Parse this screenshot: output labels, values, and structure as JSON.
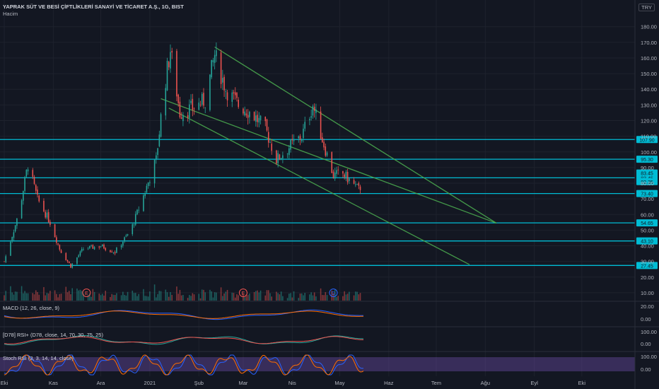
{
  "header": {
    "title": "YAPRAK SÜT VE BESİ ÇİFTLİKLERİ SANAYİ VE TİCARET A.Ş., 1G, BIST",
    "volume_label": "Hacim",
    "currency": "TRY"
  },
  "indicators": {
    "macd_label": "MACD (12, 26, close, 9)",
    "rsi_label": "[D78] RSI+ (D78, close, 14, 70, 30, 75, 25)",
    "stoch_label": "Stoch RSI (3, 3, 14, 14, close)"
  },
  "colors": {
    "background": "#131722",
    "up": "#26a69a",
    "down": "#ef5350",
    "level_line": "#00bcd4",
    "channel_line": "#4caf50",
    "macd_line": "#2962ff",
    "signal_line": "#ff6d00",
    "stoch_k": "#2962ff",
    "stoch_d": "#ff6d00",
    "stoch_band": "#7e57c2"
  },
  "chart_data": {
    "type": "candlestick",
    "y_axis": {
      "ticks": [
        10,
        20,
        30,
        40,
        50,
        60,
        70,
        80,
        90,
        100,
        110,
        120,
        130,
        140,
        150,
        160,
        170,
        180
      ],
      "tick_labels": [
        "10.00",
        "20.00",
        "30.00",
        "40.00",
        "50.00",
        "60.00",
        "70.00",
        "80.00",
        "90.00",
        "100.00",
        "110.00",
        "120.00",
        "130.00",
        "140.00",
        "150.00",
        "160.00",
        "170.00",
        "180.00"
      ],
      "range": [
        5,
        188
      ]
    },
    "x_axis": {
      "range": [
        "2020-10-01",
        "2021-10-31"
      ],
      "ticks": [
        {
          "date": "2020-10-01",
          "label": "Eki"
        },
        {
          "date": "2020-11-01",
          "label": "Kas"
        },
        {
          "date": "2020-12-01",
          "label": "Ara"
        },
        {
          "date": "2021-01-01",
          "label": "2021"
        },
        {
          "date": "2021-02-01",
          "label": "Şub"
        },
        {
          "date": "2021-03-01",
          "label": "Mar"
        },
        {
          "date": "2021-04-01",
          "label": "Nis"
        },
        {
          "date": "2021-05-01",
          "label": "May"
        },
        {
          "date": "2021-06-01",
          "label": "Haz"
        },
        {
          "date": "2021-07-01",
          "label": "Tem"
        },
        {
          "date": "2021-08-01",
          "label": "Ağu"
        },
        {
          "date": "2021-09-01",
          "label": "Eyl"
        },
        {
          "date": "2021-10-01",
          "label": "Eki"
        }
      ]
    },
    "price_path": [
      {
        "date": "2020-10-01",
        "close": 30
      },
      {
        "date": "2020-10-10",
        "close": 60
      },
      {
        "date": "2020-10-16",
        "close": 92
      },
      {
        "date": "2020-10-22",
        "close": 70
      },
      {
        "date": "2020-10-30",
        "close": 55
      },
      {
        "date": "2020-11-05",
        "close": 38
      },
      {
        "date": "2020-11-12",
        "close": 27
      },
      {
        "date": "2020-11-20",
        "close": 38
      },
      {
        "date": "2020-12-01",
        "close": 40
      },
      {
        "date": "2020-12-10",
        "close": 36
      },
      {
        "date": "2020-12-20",
        "close": 50
      },
      {
        "date": "2020-12-28",
        "close": 72
      },
      {
        "date": "2021-01-05",
        "close": 95
      },
      {
        "date": "2021-01-10",
        "close": 140
      },
      {
        "date": "2021-01-14",
        "close": 165
      },
      {
        "date": "2021-01-20",
        "close": 125
      },
      {
        "date": "2021-01-28",
        "close": 128
      },
      {
        "date": "2021-02-05",
        "close": 133
      },
      {
        "date": "2021-02-11",
        "close": 162
      },
      {
        "date": "2021-02-18",
        "close": 140
      },
      {
        "date": "2021-02-26",
        "close": 130
      },
      {
        "date": "2021-03-06",
        "close": 125
      },
      {
        "date": "2021-03-15",
        "close": 115
      },
      {
        "date": "2021-03-22",
        "close": 95
      },
      {
        "date": "2021-03-30",
        "close": 103
      },
      {
        "date": "2021-04-07",
        "close": 110
      },
      {
        "date": "2021-04-14",
        "close": 130
      },
      {
        "date": "2021-04-20",
        "close": 108
      },
      {
        "date": "2021-04-27",
        "close": 85
      },
      {
        "date": "2021-05-03",
        "close": 86
      },
      {
        "date": "2021-05-08",
        "close": 81
      },
      {
        "date": "2021-05-13",
        "close": 76
      },
      {
        "date": "2021-05-16",
        "close": 80
      }
    ],
    "horizontal_levels": [
      {
        "value": 107.9,
        "label": "107.90"
      },
      {
        "value": 95.3,
        "label": "95.30"
      },
      {
        "value": 83.45,
        "label": "83.45"
      },
      {
        "value": 73.4,
        "label": "73.40"
      },
      {
        "value": 54.65,
        "label": "54.65"
      },
      {
        "value": 43.1,
        "label": "43.10"
      },
      {
        "value": 27.45,
        "label": "27.45"
      }
    ],
    "price_tags": [
      {
        "value": 86.5,
        "label": "83.45"
      },
      {
        "value": 81.0,
        "label": "82.35"
      }
    ],
    "channel_lines": [
      {
        "from": {
          "date": "2021-01-08",
          "value": 134
        },
        "to": {
          "date": "2021-08-08",
          "value": 54.5
        }
      },
      {
        "from": {
          "date": "2021-01-13",
          "value": 128
        },
        "to": {
          "date": "2021-07-22",
          "value": 28
        }
      },
      {
        "from": {
          "date": "2021-02-11",
          "value": 167
        },
        "to": {
          "date": "2021-08-08",
          "value": 54.5
        }
      }
    ],
    "event_markers": [
      {
        "date": "2020-11-22",
        "label": "E"
      },
      {
        "date": "2021-03-01",
        "label": "E"
      },
      {
        "date": "2021-04-27",
        "label": "D"
      }
    ],
    "macd_axis": {
      "ticks": [
        20,
        0
      ],
      "tick_labels": [
        "20.00",
        "0.00"
      ]
    },
    "rsi_axis": {
      "ticks": [
        100,
        0
      ],
      "tick_labels": [
        "100.00",
        "0.00"
      ]
    },
    "stoch_axis": {
      "ticks": [
        100,
        0
      ],
      "tick_labels": [
        "100.00",
        "0.00"
      ]
    }
  }
}
